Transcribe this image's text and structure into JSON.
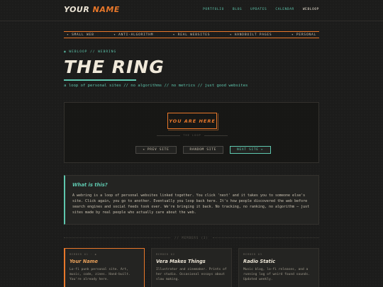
{
  "header": {
    "logo_prefix": "YOUR",
    "logo_accent": "NAME",
    "nav": [
      {
        "label": "PORTFOLIO",
        "active": false
      },
      {
        "label": "BLOG",
        "active": false
      },
      {
        "label": "UPDATES",
        "active": false
      },
      {
        "label": "CALENDAR",
        "active": false
      },
      {
        "label": "WEBLOOP",
        "active": true
      }
    ]
  },
  "ticker": [
    "✦ SMALL WEB",
    "✦ ANTI-ALGORITHM",
    "✦ REAL WEBSITES",
    "✦ HANDBUILT PAGES",
    "✦ PERSONAL"
  ],
  "page": {
    "breadcrumb": "◉ WEBLOOP // WEBRING",
    "title": "THE RING",
    "subtitle": "a loop of personal sites // no algorithms // no metrics // just good websites"
  },
  "ring": {
    "current_label": "YOU ARE HERE",
    "divider_text": "THE LOOP",
    "prev_label": "◂ PREV SITE",
    "random_label": "RANDOM SITE",
    "next_label": "NEXT SITE ▸"
  },
  "about": {
    "title": "What is this?",
    "body": "A webring is a loop of personal websites linked together. You click 'next' and it takes you to someone else's site. Click again, you go to another. Eventually you loop back here. It's how people discovered the web before search engines and social feeds took over. We're bringing it back. No tracking, no ranking, no algorithm — just sites made by real people who actually care about the web."
  },
  "members": {
    "divider": "// MEMBERS (3)",
    "items": [
      {
        "meta": "MEMBER 01 · ◆",
        "name": "Your Name",
        "desc": "Lo-fi punk personal site. Art, music, code, zines. Hand-built. You're already here.",
        "active": true
      },
      {
        "meta": "MEMBER 02",
        "name": "Vera Makes Things",
        "desc": "Illustrator and zinemaker. Prints of her studio. Occasional essays about slow making.",
        "active": false
      },
      {
        "meta": "MEMBER 03",
        "name": "Radio Static",
        "desc": "Music blog, lo-fi releases, and a running log of weird found sounds. Updated weekly.",
        "active": false
      }
    ]
  },
  "colors": {
    "accent": "#e8772a",
    "teal": "#5ec7ae",
    "background": "#1c1c1b"
  }
}
